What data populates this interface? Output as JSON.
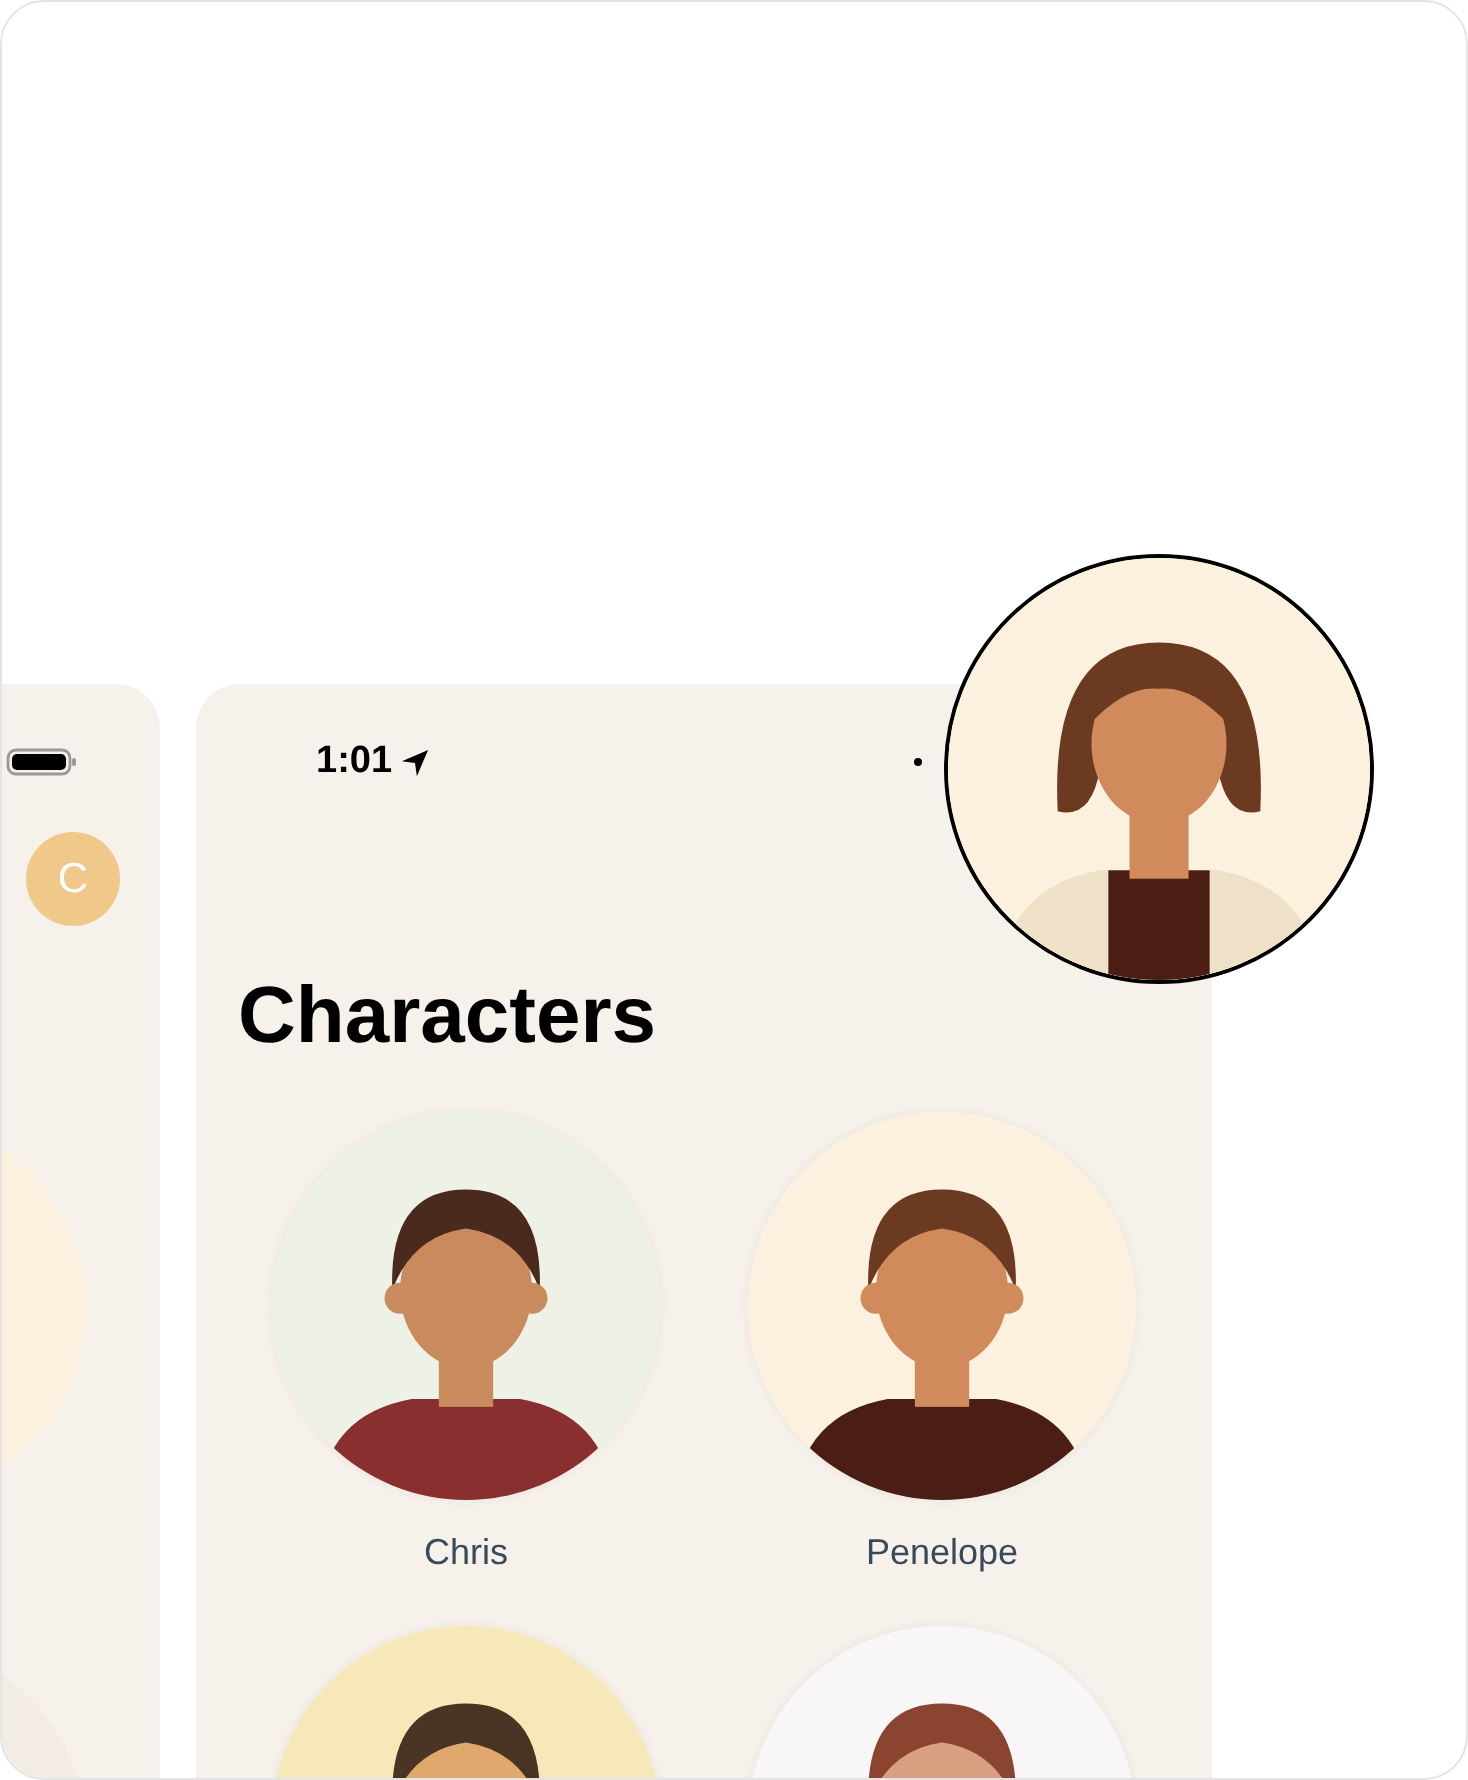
{
  "side_card": {
    "avatar_letter": "C"
  },
  "status_bar": {
    "time": "1:01"
  },
  "title": "Characters",
  "characters": [
    {
      "kind": "picture",
      "name": "Chris"
    },
    {
      "kind": "picture",
      "name": "Penelope"
    },
    {
      "kind": "picture"
    },
    {
      "kind": "picture"
    }
  ]
}
